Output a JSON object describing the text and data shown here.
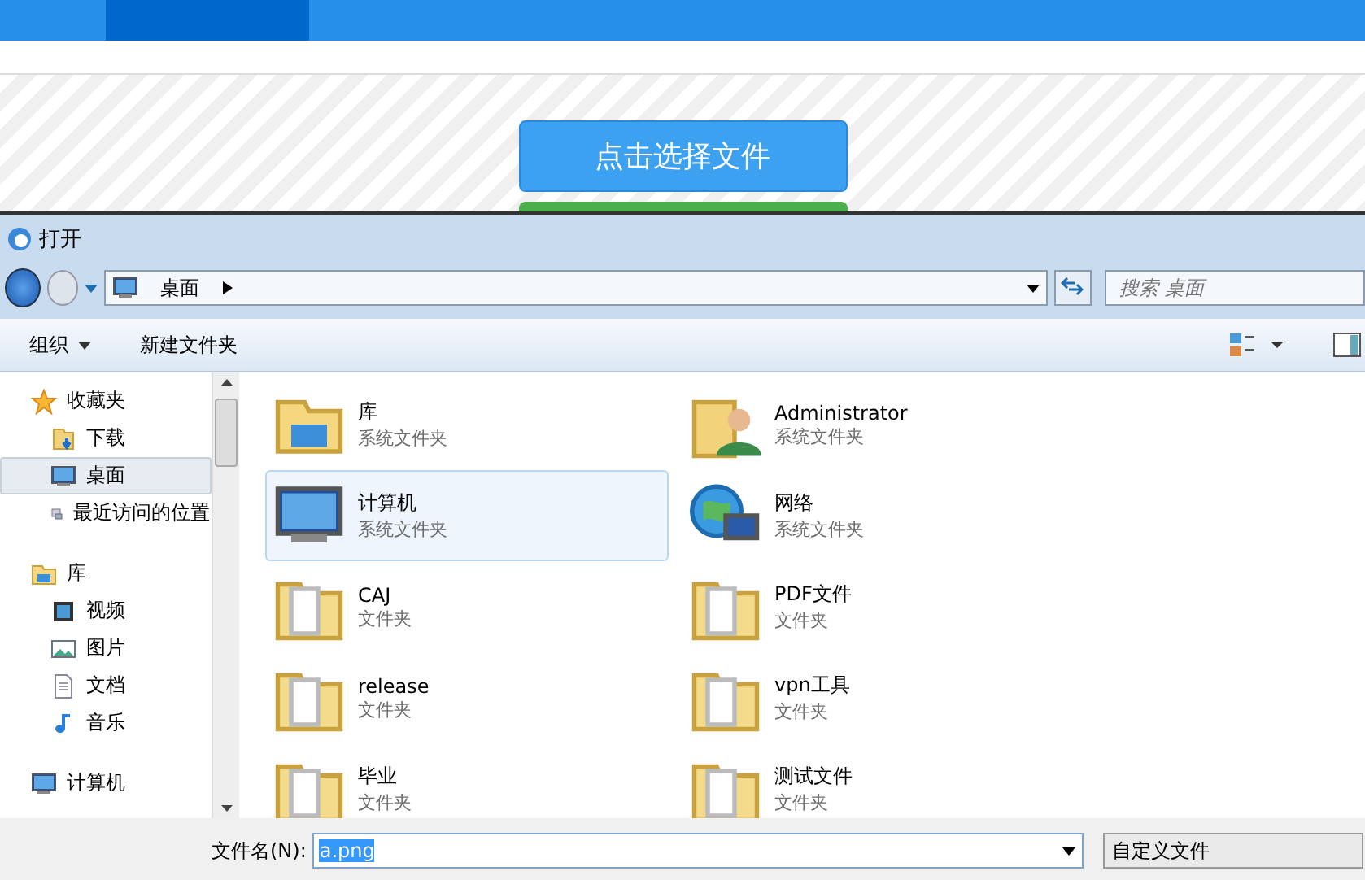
{
  "page": {
    "tabs": [
      {
        "selected": false
      },
      {
        "selected": true
      },
      {
        "selected": false
      },
      {
        "selected": false
      }
    ],
    "choose_button": "点击选择文件"
  },
  "dialog": {
    "title": "打开",
    "address": "桌面",
    "search": {
      "placeholder": "搜索 桌面"
    },
    "toolbar": [
      "组织",
      "新建文件夹"
    ],
    "nav": [
      {
        "label": "收藏夹",
        "kind": "star",
        "selected": false,
        "children": [
          {
            "label": "下载",
            "kind": "download",
            "selected": false
          },
          {
            "label": "桌面",
            "kind": "desktop",
            "selected": true
          },
          {
            "label": "最近访问的位置",
            "kind": "recent",
            "selected": false
          }
        ]
      },
      {
        "label": "库",
        "kind": "library",
        "selected": false,
        "children": [
          {
            "label": "视频",
            "kind": "video",
            "selected": false
          },
          {
            "label": "图片",
            "kind": "picture",
            "selected": false
          },
          {
            "label": "文档",
            "kind": "document",
            "selected": false
          },
          {
            "label": "音乐",
            "kind": "music",
            "selected": false
          }
        ]
      },
      {
        "label": "计算机",
        "kind": "computer",
        "selected": false
      }
    ],
    "files": [
      {
        "name": "库",
        "type": "系统文件夹",
        "kind": "library",
        "selected": false
      },
      {
        "name": "Administrator",
        "type": "系统文件夹",
        "kind": "user",
        "selected": false
      },
      {
        "name": "计算机",
        "type": "系统文件夹",
        "kind": "computer",
        "selected": true
      },
      {
        "name": "网络",
        "type": "系统文件夹",
        "kind": "network",
        "selected": false
      },
      {
        "name": "CAJ",
        "type": "文件夹",
        "kind": "folder",
        "selected": false
      },
      {
        "name": "PDF文件",
        "type": "文件夹",
        "kind": "folder",
        "selected": false
      },
      {
        "name": "release",
        "type": "文件夹",
        "kind": "folder",
        "selected": false
      },
      {
        "name": "vpn工具",
        "type": "文件夹",
        "kind": "folder",
        "selected": false
      },
      {
        "name": "毕业",
        "type": "文件夹",
        "kind": "folder",
        "selected": false
      },
      {
        "name": "测试文件",
        "type": "文件夹",
        "kind": "folder",
        "selected": false
      }
    ],
    "filename_label": "文件名(N):",
    "filename": "a.png",
    "filetype": "自定义文件"
  }
}
